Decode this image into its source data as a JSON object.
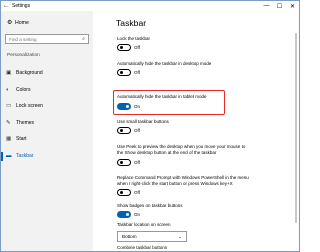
{
  "window": {
    "title": "Settings",
    "back_icon": "back-arrow-icon",
    "minimize": "—",
    "maximize": "☐",
    "close": "✕"
  },
  "sidebar": {
    "home_label": "Home",
    "search_placeholder": "Find a setting",
    "section": "Personalization",
    "items": [
      {
        "label": "Background",
        "icon": "picture-icon"
      },
      {
        "label": "Colors",
        "icon": "palette-icon"
      },
      {
        "label": "Lock screen",
        "icon": "lock-screen-icon"
      },
      {
        "label": "Themes",
        "icon": "brush-icon"
      },
      {
        "label": "Start",
        "icon": "start-icon"
      },
      {
        "label": "Taskbar",
        "icon": "taskbar-icon",
        "active": true
      }
    ]
  },
  "main": {
    "title": "Taskbar",
    "settings": [
      {
        "label": "Lock the taskbar",
        "state": "Off"
      },
      {
        "label": "Automatically hide the taskbar in desktop mode",
        "state": "Off"
      },
      {
        "label": "Automatically hide the taskbar in tablet mode",
        "state": "On"
      },
      {
        "label": "Use small taskbar buttons",
        "state": "Off"
      },
      {
        "label_line1": "Use Peek to preview the desktop when you move your mouse to",
        "label_line2": "the Show desktop button at the end of the taskbar",
        "state": "Off"
      },
      {
        "label_line1": "Replace Command Prompt with Windows PowerShell in the menu",
        "label_line2": "when I right-click the start button or press Windows key+X",
        "state": "Off"
      },
      {
        "label": "Show badges on taskbar buttons",
        "state": "On"
      }
    ],
    "location_label": "Taskbar location on screen",
    "location_value": "Bottom",
    "combine_label": "Combine taskbar buttons"
  },
  "colors": {
    "accent": "#0063b1",
    "highlight": "#e52d2d"
  }
}
